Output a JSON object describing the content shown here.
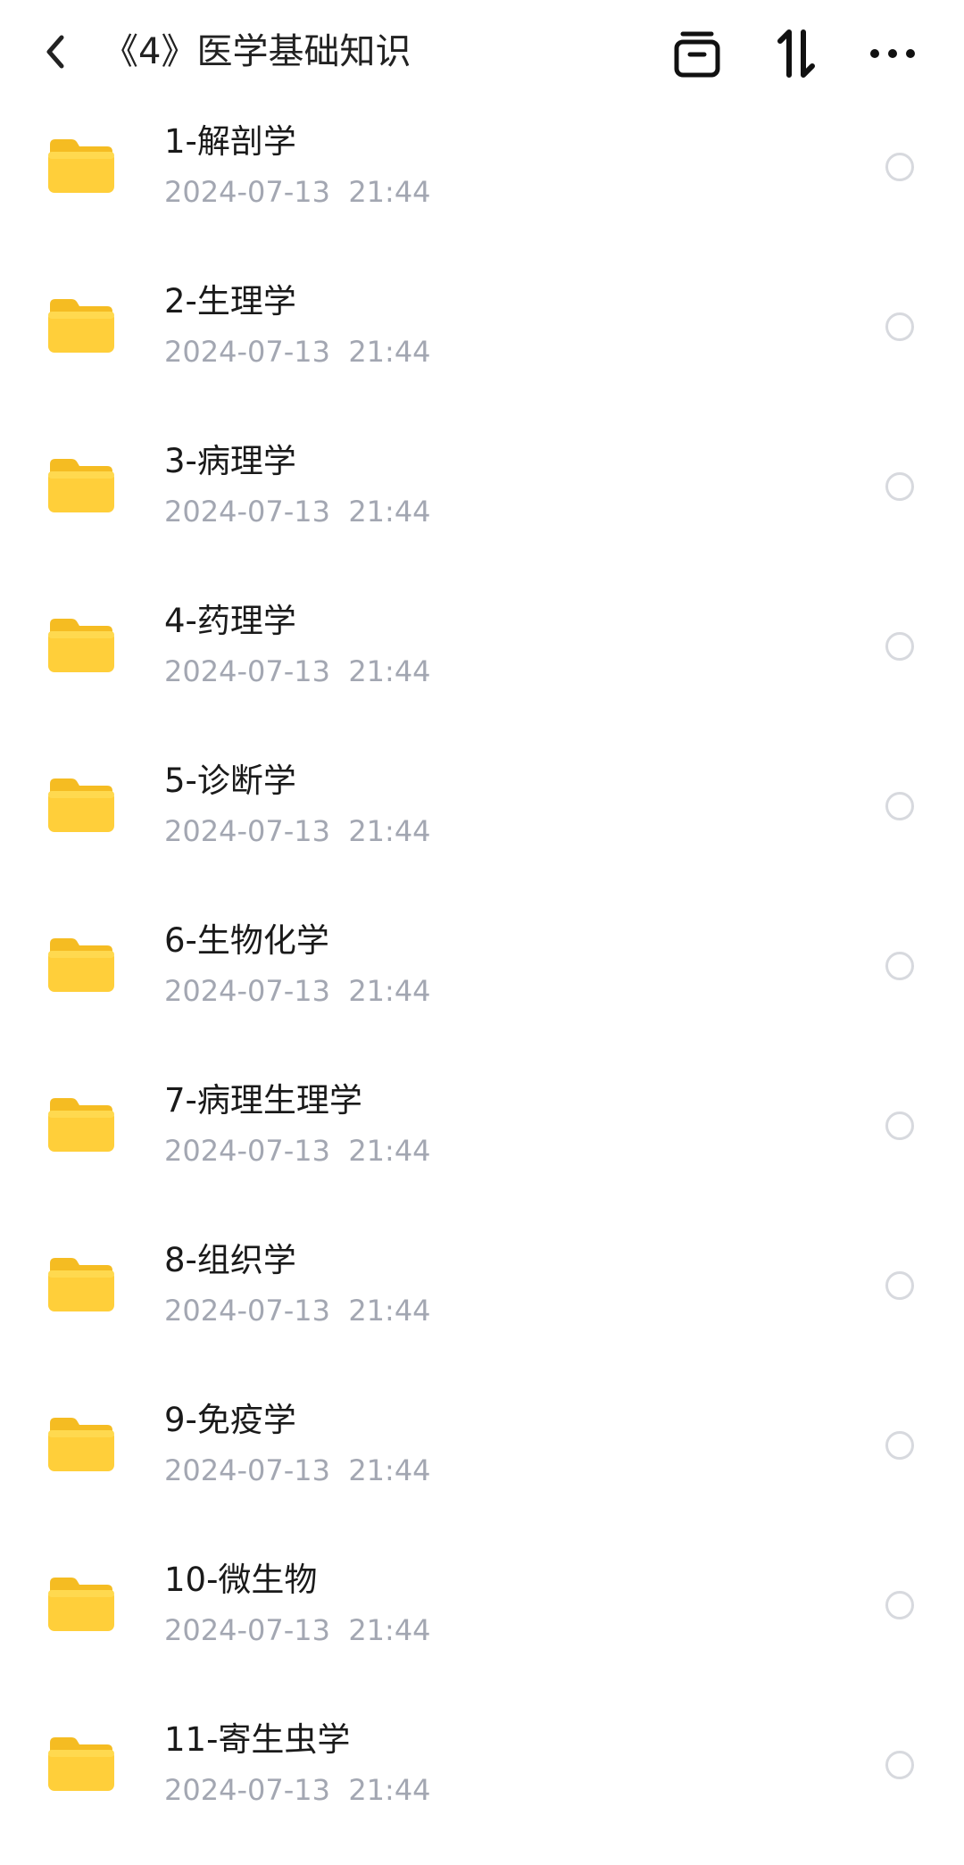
{
  "header": {
    "title": "《4》医学基础知识",
    "back_icon": "chevron-left-icon",
    "icons": [
      "archive-box-icon",
      "sort-arrows-icon",
      "more-dots-icon"
    ]
  },
  "colors": {
    "folder": "#FFCC33",
    "folder_tab": "#F8C12A",
    "date_text": "#A3A7B2",
    "radio_border": "#D7D9DE"
  },
  "items": [
    {
      "name": "1-解剖学",
      "date": "2024-07-13  21:44"
    },
    {
      "name": "2-生理学",
      "date": "2024-07-13  21:44"
    },
    {
      "name": "3-病理学",
      "date": "2024-07-13  21:44"
    },
    {
      "name": "4-药理学",
      "date": "2024-07-13  21:44"
    },
    {
      "name": "5-诊断学",
      "date": "2024-07-13  21:44"
    },
    {
      "name": "6-生物化学",
      "date": "2024-07-13  21:44"
    },
    {
      "name": "7-病理生理学",
      "date": "2024-07-13  21:44"
    },
    {
      "name": "8-组织学",
      "date": "2024-07-13  21:44"
    },
    {
      "name": "9-免疫学",
      "date": "2024-07-13  21:44"
    },
    {
      "name": "10-微生物",
      "date": "2024-07-13  21:44"
    },
    {
      "name": "11-寄生虫学",
      "date": "2024-07-13  21:44"
    }
  ]
}
